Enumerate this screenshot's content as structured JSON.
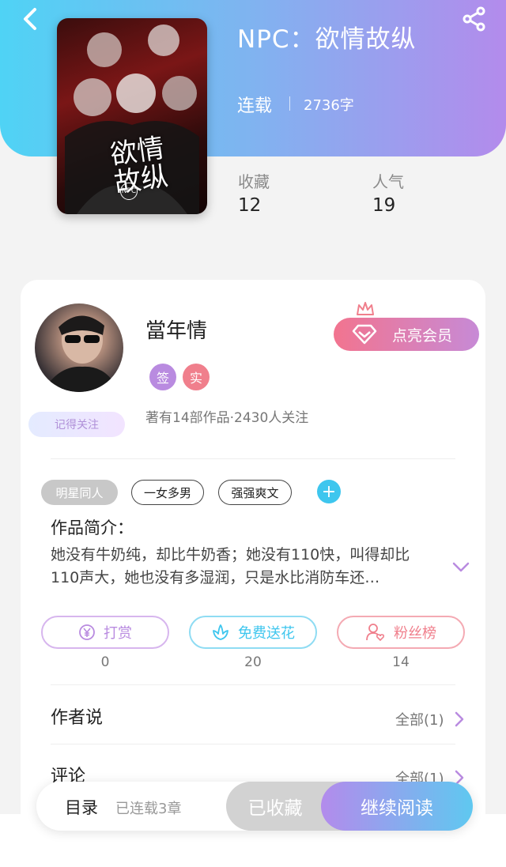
{
  "header": {
    "title": "NPC：欲情故纵",
    "status": "连载",
    "word_count": "2736字"
  },
  "cover": {
    "title_art": "欲情故纵",
    "emblem": "NPC"
  },
  "stats": [
    {
      "label": "收藏",
      "value": "12"
    },
    {
      "label": "人气",
      "value": "19"
    }
  ],
  "author": {
    "name": "當年情",
    "badges": [
      "签",
      "实"
    ],
    "meta": "著有14部作品·2430人关注",
    "follow_label": "记得关注",
    "vip_label": "点亮会员"
  },
  "tags": [
    "明星同人",
    "一女多男",
    "强强爽文"
  ],
  "tag_add_symbol": "+",
  "intro": {
    "title": "作品简介：",
    "text": "她没有牛奶纯，却比牛奶香；她没有110快，叫得却比110声大，她也没有多湿润，只是水比消防车还…"
  },
  "actions": [
    {
      "label": "打赏",
      "count": "0",
      "color": "#b98be0"
    },
    {
      "label": "免费送花",
      "count": "20",
      "color": "#3ec6ee"
    },
    {
      "label": "粉丝榜",
      "count": "14",
      "color": "#f07f8c"
    }
  ],
  "sections": [
    {
      "title": "作者说",
      "link": "全部(1)"
    },
    {
      "title": "评论",
      "link": "全部(1)"
    }
  ],
  "bottom": {
    "toc_label": "目录",
    "toc_status": "已连载3章",
    "fav_label": "已收藏",
    "read_label": "继续阅读"
  }
}
